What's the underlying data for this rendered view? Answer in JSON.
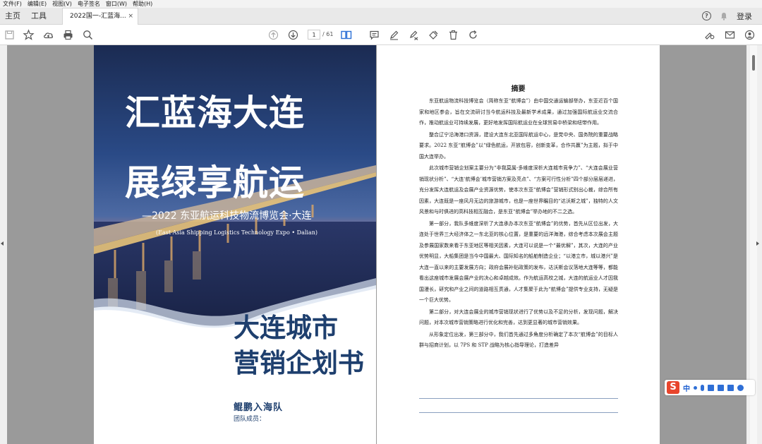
{
  "menu": [
    "文件(F)",
    "编辑(E)",
    "视图(V)",
    "电子签名",
    "窗口(W)",
    "帮助(H)"
  ],
  "tabs": {
    "home": "主页",
    "tools": "工具",
    "doc": "2022国一-汇蓝海...",
    "close": "×"
  },
  "header": {
    "help": "?",
    "login": "登录"
  },
  "toolbar": {
    "page_current": "1",
    "page_total": "/ 61"
  },
  "cover": {
    "title_line1": "汇蓝海大连",
    "title_line2": "展绿享航运",
    "subtitle": "—2022 东亚航运科技物流博览会·大连",
    "subtitle_en": "(East Asia Shipping Logistics Technology Expo • Dalian)",
    "book_line1": "大连城市",
    "book_line2": "营销企划书",
    "team": "鲲鹏入海队",
    "members": "团队成员："
  },
  "abstract": {
    "title": "摘要",
    "paragraphs": [
      "东亚航运物流科技博览会（简称东亚“航博会”）由中国交通运输部举办，东亚近百个国家和地区参会，旨在交流研讨当今航运科技及最新学术成果，通过加强国际航运业交流合作，推动航运业可持续发展，更好地发挥国际航运业在全球贸易中桥梁和纽带作用。",
      "整合辽宁沿海港口资源，建设大连东北亚国际航运中心，是党中央、国务院的重要战略要求。2022 东亚“航博会”以“绿色航运，开放包容，创新变革，合作共赢”为主题，拟于中国大连举办。",
      "此次城市营销企划案主要分为“非我莫属-多维度深析大连城市竞争力”、“大连会展业营销现状分析”、“大连‘航博会’城市营销方案及亮点”、“方案可行性分析”四个部分层层递进，充分发挥大连航运及会展产业资源优势，使本次东亚“航博会”营销形式别出心裁，综合所有因素，大连既是一座风月无边的旅游城市，也是一座世界瞩目的“达沃斯之城”，独特的人文风景和与时俱进的高科技相互融合，是东亚“航博会”举办地的不二之选。",
      "第一部分，我队多维度深析了大连承办本次东亚“航博会”的优势，首先从区位出发，大连处于世界三大经济体之一东北亚的核心位置，是重要的远洋海港，综合考虑本次展会主题及参展国家数来看于东亚地区等相关因素，大连可以说是一个“最优解”，其次，大连的产业优势明显，大船集团是当今中国最大、国际知名的船舶制造企业；“以港立市，城以港兴”是大连一直以来的主要发展方向；政府会展补贴政策的发布，达沃斯会议落地大连等等，都能看出这座城市发展会展产业的决心和卓越成效。作为航运高校之城，大连的航运业人才因我国漫长，研究和产业之间的道路相互贯通，人才集聚于此为“航博会”提供专业支持，无疑是一个巨大优势。",
      "第二部分，对大连会展业的城市营销现状进行了优势以及不足的分析，发现问题，解决问题，对本次城市营销策略进行优化和完善，达到更显著的城市营销效果。",
      "从形象定位出发，第三部分中，我们首先通过多角度分析确定了本次“航博会”的目标人群与招商计划，以 7PS 和 STP 战略为核心指导理论，打造差异"
    ]
  },
  "ime": {
    "logo": "S",
    "lang": "中"
  }
}
